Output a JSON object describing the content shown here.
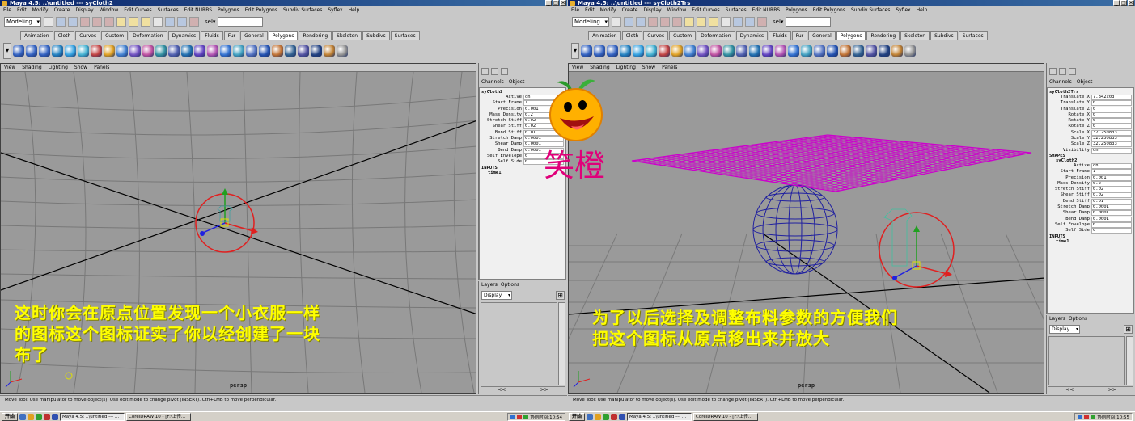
{
  "windows": [
    {
      "title": "Maya 4.5: ..\\untitled  ---  syCloth2",
      "menus": [
        "File",
        "Edit",
        "Modify",
        "Create",
        "Display",
        "Window",
        "Edit Curves",
        "Surfaces",
        "Edit NURBS",
        "Polygons",
        "Edit Polygons",
        "Subdiv Surfaces",
        "Syflex",
        "Help"
      ],
      "mode": "Modeling",
      "sel_label": "sel▾",
      "shelf_tabs": [
        "Animation",
        "Cloth",
        "Curves",
        "Custom",
        "Deformation",
        "Dynamics",
        "Fluids",
        "Fur",
        "General",
        "Polygons",
        "Rendering",
        "Skeleton",
        "Subdivs",
        "Surfaces"
      ],
      "active_tab": "Polygons",
      "panel_menu": [
        "View",
        "Shading",
        "Lighting",
        "Show",
        "Panels"
      ],
      "camera": "persp",
      "caption": [
        "这时你会在原点位置发现一个小衣服一样",
        "的图标这个图标证实了你以经创建了一块",
        "布了"
      ],
      "channel_menu": [
        "Channels",
        "Object"
      ],
      "node": "syCloth2",
      "channels": [
        {
          "k": "Active",
          "v": "on"
        },
        {
          "k": "Start Frame",
          "v": "1"
        },
        {
          "k": "Precision",
          "v": "0.001"
        },
        {
          "k": "Mass Density",
          "v": "0.2"
        },
        {
          "k": "Stretch Stiff",
          "v": "0.02"
        },
        {
          "k": "Shear Stiff",
          "v": "0.02"
        },
        {
          "k": "Bend Stiff",
          "v": "0.01"
        },
        {
          "k": "Stretch Damp",
          "v": "0.0001"
        },
        {
          "k": "Shear Damp",
          "v": "0.0001"
        },
        {
          "k": "Bend Damp",
          "v": "0.0001"
        },
        {
          "k": "Self Envelope",
          "v": "0"
        },
        {
          "k": "Self Side",
          "v": "0"
        }
      ],
      "inputs_label": "INPUTS",
      "inputs": [
        "time1"
      ],
      "layers_menu": [
        "Layers",
        "Options"
      ],
      "layers_mode": "Display",
      "help": "Move Tool: Use manipulator to move object(s). Use edit mode to change pivot (INSERT). Ctrl+LMB to move perpendicular."
    },
    {
      "title": "Maya 4.5: ..\\untitled  ---  syCloth2Trs",
      "menus": [
        "File",
        "Edit",
        "Modify",
        "Create",
        "Display",
        "Window",
        "Edit Curves",
        "Surfaces",
        "Edit NURBS",
        "Polygons",
        "Edit Polygons",
        "Subdiv Surfaces",
        "Syflex",
        "Help"
      ],
      "mode": "Modeling",
      "sel_label": "sel▾",
      "shelf_tabs": [
        "Animation",
        "Cloth",
        "Curves",
        "Custom",
        "Deformation",
        "Dynamics",
        "Fluids",
        "Fur",
        "General",
        "Polygons",
        "Rendering",
        "Skeleton",
        "Subdivs",
        "Surfaces"
      ],
      "active_tab": "Polygons",
      "panel_menu": [
        "View",
        "Shading",
        "Lighting",
        "Show",
        "Panels"
      ],
      "camera": "persp",
      "caption": [
        "为了以后选择及调整布料参数的方便我们",
        "把这个图标从原点移出来并放大"
      ],
      "channel_menu": [
        "Channels",
        "Object"
      ],
      "node": "syCloth2Trs",
      "channels": [
        {
          "k": "Translate X",
          "v": "7.842203"
        },
        {
          "k": "Translate Y",
          "v": "0"
        },
        {
          "k": "Translate Z",
          "v": "0"
        },
        {
          "k": "Rotate X",
          "v": "0"
        },
        {
          "k": "Rotate Y",
          "v": "0"
        },
        {
          "k": "Rotate Z",
          "v": "0"
        },
        {
          "k": "Scale X",
          "v": "32.250833"
        },
        {
          "k": "Scale Y",
          "v": "32.250833"
        },
        {
          "k": "Scale Z",
          "v": "32.250833"
        },
        {
          "k": "Visibility",
          "v": "on"
        }
      ],
      "shapes_label": "SHAPES",
      "shape_node": "syCloth2",
      "shape_channels": [
        {
          "k": "Active",
          "v": "on"
        },
        {
          "k": "Start Frame",
          "v": "1"
        },
        {
          "k": "Precision",
          "v": "0.001"
        },
        {
          "k": "Mass Density",
          "v": "0.2"
        },
        {
          "k": "Stretch Stiff",
          "v": "0.02"
        },
        {
          "k": "Shear Stiff",
          "v": "0.02"
        },
        {
          "k": "Bend Stiff",
          "v": "0.01"
        },
        {
          "k": "Stretch Damp",
          "v": "0.0001"
        },
        {
          "k": "Shear Damp",
          "v": "0.0001"
        },
        {
          "k": "Bend Damp",
          "v": "0.0001"
        },
        {
          "k": "Self Envelope",
          "v": "0"
        },
        {
          "k": "Self Side",
          "v": "0"
        }
      ],
      "inputs_label": "INPUTS",
      "inputs": [
        "time1"
      ],
      "layers_menu": [
        "Layers",
        "Options"
      ],
      "layers_mode": "Display",
      "help": "Move Tool: Use manipulator to move object(s). Use edit mode to change pivot (INSERT). Ctrl+LMB to move perpendicular."
    }
  ],
  "sticker_text": "笑橙",
  "taskbar": {
    "start": "开始",
    "tasks": [
      "Maya 4.5: ..\\untitled  --- ...",
      "CorelDRAW 10 - [F:\\上传..."
    ],
    "clock_left": "协创时间:10:54",
    "clock_right": "协创时间:10:55"
  },
  "colors": {
    "cloth": "#cc00cc",
    "sphere": "#2020a0",
    "manip_red": "#e02020",
    "grid": "#6a6a6a",
    "caption": "#ffff00"
  }
}
